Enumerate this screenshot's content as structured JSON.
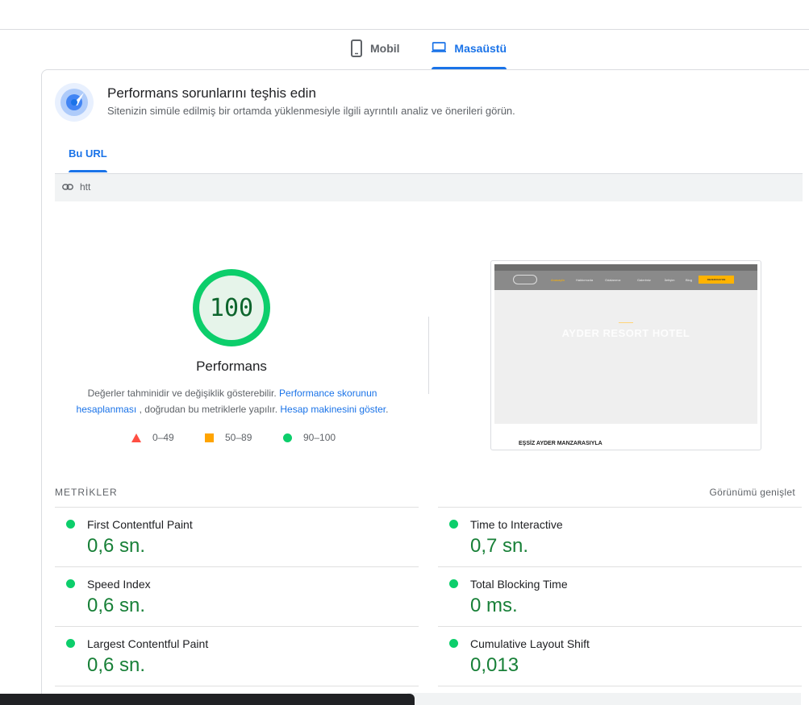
{
  "device_tabs": {
    "mobile": "Mobil",
    "desktop": "Masaüstü"
  },
  "header": {
    "title": "Performans sorunlarını teşhis edin",
    "subtitle": "Sitenizin simüle edilmiş bir ortamda yüklenmesiyle ilgili ayrıntılı analiz ve önerileri görün."
  },
  "url_tab": "Bu URL",
  "url_text": "htt",
  "score": {
    "value": "100",
    "label": "Performans",
    "desc_1": "Değerler tahminidir ve değişiklik gösterebilir. ",
    "desc_link_1": "Performance skorunun hesaplanması",
    "desc_2": " , doğrudan bu metriklerle yapılır. ",
    "desc_link_2": "Hesap makinesini göster",
    "desc_3": "."
  },
  "legend": {
    "fail": "0–49",
    "average": "50–89",
    "pass": "90–100"
  },
  "screenshot": {
    "hero_title": "AYDER RESORT HOTEL",
    "section": "EŞSİZ AYDER MANZARASIYLA",
    "book": "REZERVASYON",
    "nav": [
      "Anasayfa",
      "Hakkımızda",
      "Odalarımız",
      "Galerimiz",
      "İletişim",
      "Blog"
    ]
  },
  "metrics": {
    "heading": "METRİKLER",
    "expand": "Görünümü genişlet",
    "items": [
      {
        "label": "First Contentful Paint",
        "value": "0,6 sn."
      },
      {
        "label": "Time to Interactive",
        "value": "0,7 sn."
      },
      {
        "label": "Speed Index",
        "value": "0,6 sn."
      },
      {
        "label": "Total Blocking Time",
        "value": "0 ms."
      },
      {
        "label": "Largest Contentful Paint",
        "value": "0,6 sn."
      },
      {
        "label": "Cumulative Layout Shift",
        "value": "0,013"
      }
    ]
  },
  "colors": {
    "accent": "#1a73e8",
    "pass": "#0cce6b",
    "average": "#ffa400",
    "fail": "#ff4e42",
    "pass_text": "#188038"
  }
}
